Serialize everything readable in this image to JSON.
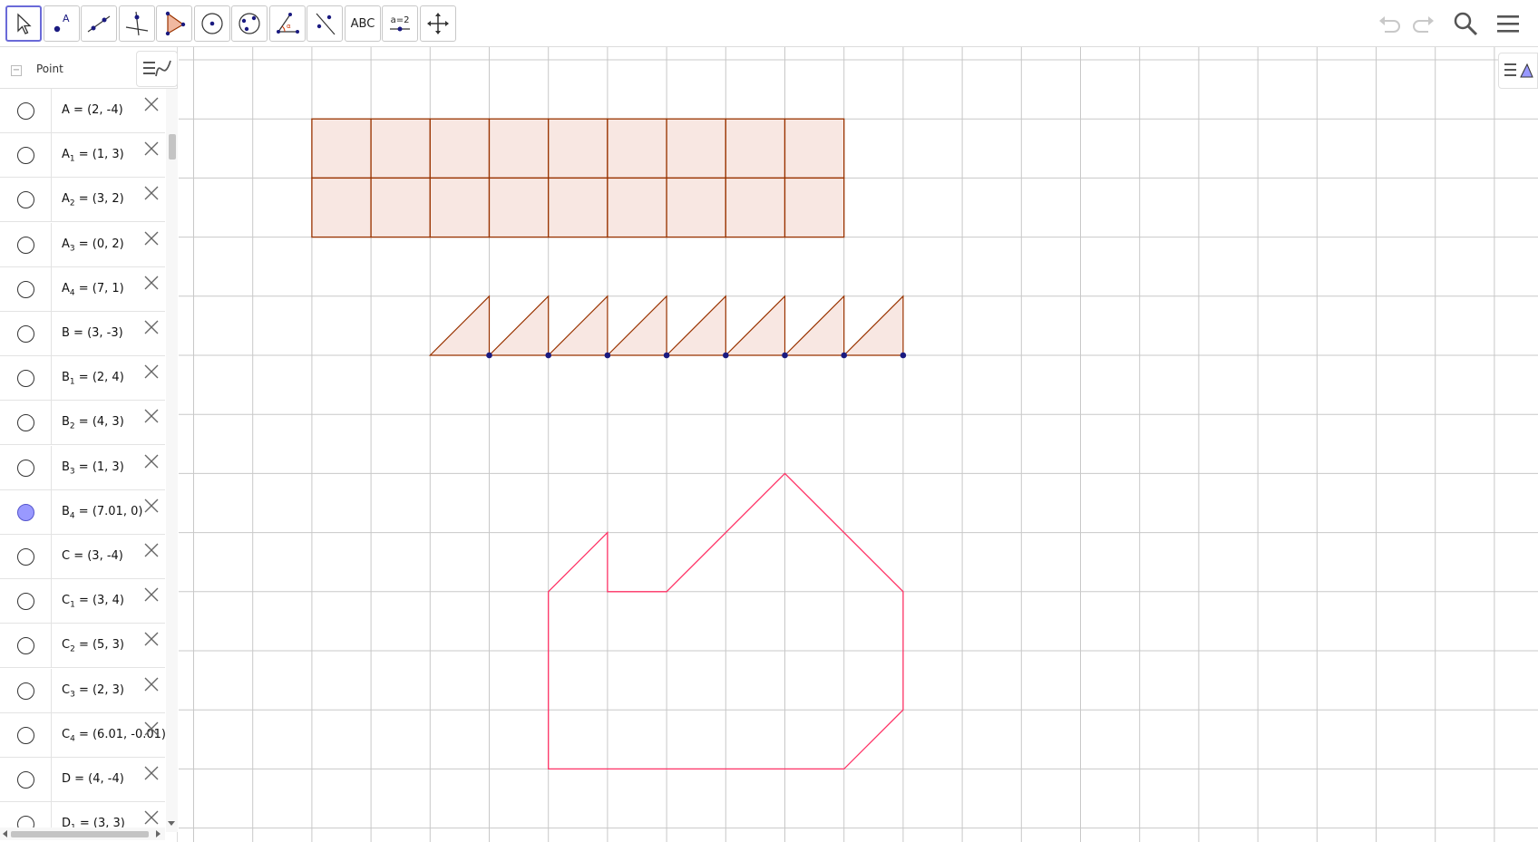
{
  "toolbar": {
    "tools": [
      {
        "name": "move-tool",
        "icon": "arrow-cursor-icon"
      },
      {
        "name": "point-tool",
        "icon": "point-icon",
        "label": "A"
      },
      {
        "name": "line-tool",
        "icon": "line-through-points-icon"
      },
      {
        "name": "perpendicular-line-tool",
        "icon": "perpendicular-line-icon"
      },
      {
        "name": "polygon-tool",
        "icon": "polygon-icon"
      },
      {
        "name": "circle-tool",
        "icon": "circle-center-point-icon"
      },
      {
        "name": "circle-three-points-tool",
        "icon": "circle-three-points-icon"
      },
      {
        "name": "angle-tool",
        "icon": "angle-icon",
        "label": "α"
      },
      {
        "name": "reflect-tool",
        "icon": "reflect-about-line-icon"
      },
      {
        "name": "text-tool",
        "icon": "text-icon",
        "label": "ABC"
      },
      {
        "name": "slider-tool",
        "icon": "slider-icon",
        "label": "a=2"
      },
      {
        "name": "move-graphics-tool",
        "icon": "move-graphics-view-icon"
      }
    ],
    "right": [
      "undo-icon",
      "redo-icon",
      "search-icon",
      "menu-icon"
    ]
  },
  "algebra": {
    "title": "Point",
    "collapse_symbol": "−",
    "rows": [
      {
        "name": "A",
        "sub": "",
        "value": "= (2, -4)",
        "shown": false
      },
      {
        "name": "A",
        "sub": "1",
        "value": "= (1, 3)",
        "shown": false
      },
      {
        "name": "A",
        "sub": "2",
        "value": "= (3, 2)",
        "shown": false
      },
      {
        "name": "A",
        "sub": "3",
        "value": "= (0, 2)",
        "shown": false
      },
      {
        "name": "A",
        "sub": "4",
        "value": "= (7, 1)",
        "shown": false
      },
      {
        "name": "B",
        "sub": "",
        "value": "= (3, -3)",
        "shown": false
      },
      {
        "name": "B",
        "sub": "1",
        "value": "= (2, 4)",
        "shown": false
      },
      {
        "name": "B",
        "sub": "2",
        "value": "= (4, 3)",
        "shown": false
      },
      {
        "name": "B",
        "sub": "3",
        "value": "= (1, 3)",
        "shown": false
      },
      {
        "name": "B",
        "sub": "4",
        "value": "= (7.01, 0)",
        "shown": true
      },
      {
        "name": "C",
        "sub": "",
        "value": "= (3, -4)",
        "shown": false
      },
      {
        "name": "C",
        "sub": "1",
        "value": "= (3, 4)",
        "shown": false
      },
      {
        "name": "C",
        "sub": "2",
        "value": "= (5, 3)",
        "shown": false
      },
      {
        "name": "C",
        "sub": "3",
        "value": "= (2, 3)",
        "shown": false
      },
      {
        "name": "C",
        "sub": "4",
        "value": "= (6.01, -0.01)",
        "shown": false
      },
      {
        "name": "D",
        "sub": "",
        "value": "= (4, -4)",
        "shown": false
      },
      {
        "name": "D",
        "sub": "1",
        "value": "= (3, 3)",
        "shown": false
      }
    ]
  },
  "colors": {
    "grid": "#c8c8c8",
    "rect_stroke": "#993300",
    "rect_fill": "#f8e7e2",
    "triangle_point": "#1a1a80",
    "outline": "#ff3366",
    "selected_mark": "#9999ff"
  }
}
